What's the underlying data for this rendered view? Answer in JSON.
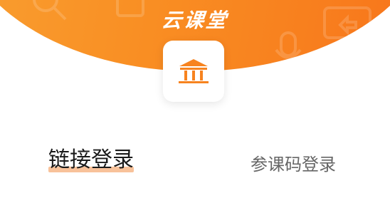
{
  "app": {
    "title": "云课堂",
    "logo_icon": "classroom-building-icon"
  },
  "login_tabs": [
    {
      "label": "链接登录",
      "active": true
    },
    {
      "label": "参课码登录",
      "active": false
    }
  ],
  "colors": {
    "header_gradient_start": "#f9a233",
    "header_gradient_end": "#f7731a",
    "accent": "#f7831f",
    "active_underline": "#f8c29a",
    "active_text": "#1a1a1a",
    "inactive_text": "#666666"
  }
}
